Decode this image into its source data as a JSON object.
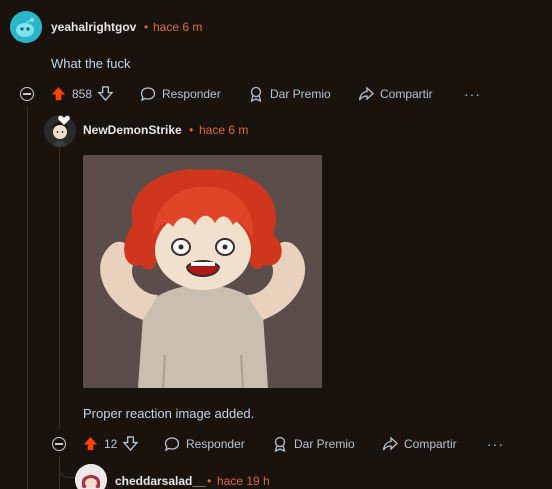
{
  "colors": {
    "background": "#1a120c",
    "accent": "#e06a3a",
    "upvote": "#ff4500",
    "text": "#c6d4e4"
  },
  "comment1": {
    "username": "yeahalrightgov",
    "separator": "•",
    "time": "hace 6 m",
    "body": "What the fuck",
    "votes": "858",
    "reply_label": "Responder",
    "award_label": "Dar Premio",
    "share_label": "Compartir",
    "more_label": "···",
    "upvote_icon": "upvote-arrow-icon",
    "downvote_icon": "downvote-arrow-icon"
  },
  "comment2": {
    "username": "NewDemonStrike",
    "separator": "•",
    "time": "hace 6 m",
    "body": "Proper reaction image added.",
    "votes": "12",
    "reply_label": "Responder",
    "award_label": "Dar Premio",
    "share_label": "Compartir",
    "more_label": "···"
  },
  "comment3": {
    "username": "cheddarsalad__",
    "separator": "•",
    "time": "hace 19 h"
  }
}
